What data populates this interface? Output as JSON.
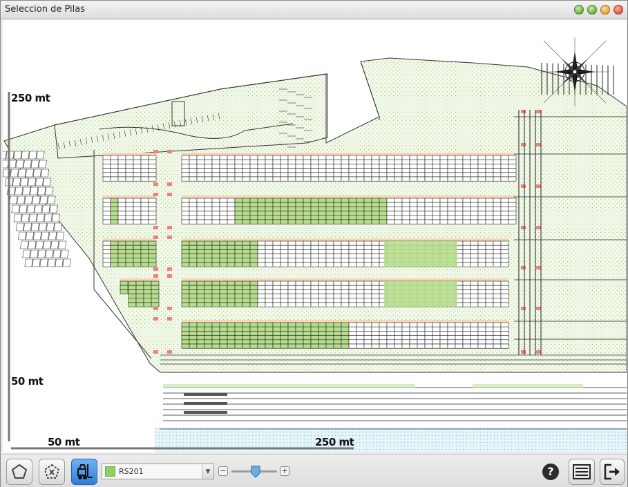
{
  "window": {
    "title": "Seleccion de Pilas"
  },
  "map": {
    "labels": {
      "top_left": "250 mt",
      "mid_left": "50 mt",
      "bottom_a": "50 mt",
      "bottom_b": "250 mt"
    },
    "colors": {
      "occupied": "#b6dd8c",
      "ground": "#e6f1d6",
      "water": "#d4ecf3",
      "marker": "#f08080",
      "header": "#f6d7b6"
    }
  },
  "toolbar": {
    "pile_select": {
      "value": "RS201",
      "swatch_color": "#8fd05a"
    },
    "help_label": "?"
  }
}
